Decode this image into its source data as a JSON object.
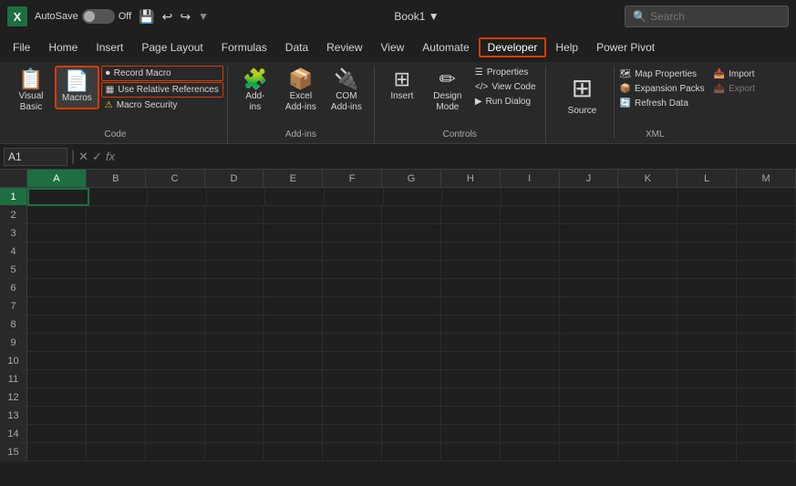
{
  "titleBar": {
    "logo": "X",
    "autosave": "AutoSave",
    "toggleState": "Off",
    "bookName": "Book1",
    "searchPlaceholder": "Search",
    "undoSymbol": "↩",
    "redoSymbol": "↪"
  },
  "menuBar": {
    "items": [
      "File",
      "Home",
      "Insert",
      "Page Layout",
      "Formulas",
      "Data",
      "Review",
      "View",
      "Automate",
      "Developer",
      "Help",
      "Power Pivot"
    ],
    "activeItem": "Developer"
  },
  "ribbon": {
    "groups": [
      {
        "label": "Code",
        "buttons": [
          {
            "id": "visual-basic",
            "icon": "📋",
            "label": "Visual\nBasic",
            "large": true,
            "highlighted": false
          },
          {
            "id": "macros",
            "icon": "📄",
            "label": "Macros",
            "large": true,
            "highlighted": true
          }
        ],
        "smallButtons": [
          {
            "id": "record-macro",
            "icon": "⏺",
            "label": "Record Macro",
            "highlighted": true
          },
          {
            "id": "use-relative",
            "icon": "▦",
            "label": "Use Relative References",
            "highlighted": true
          },
          {
            "id": "macro-security",
            "icon": "⚠",
            "label": "Macro Security",
            "warning": true,
            "highlighted": false
          }
        ]
      },
      {
        "label": "Add-ins",
        "buttons": [
          {
            "id": "add-ins",
            "icon": "🧩",
            "label": "Add-\nins",
            "large": true
          },
          {
            "id": "excel-add-ins",
            "icon": "📦",
            "label": "Excel\nAdd-ins",
            "large": true
          },
          {
            "id": "com-add-ins",
            "icon": "🔌",
            "label": "COM\nAdd-ins",
            "large": true
          }
        ]
      },
      {
        "label": "Controls",
        "buttons": [
          {
            "id": "insert-controls",
            "icon": "⊞",
            "label": "Insert",
            "large": true
          }
        ],
        "rightButtons": [
          {
            "id": "design-mode",
            "icon": "✏",
            "label": "Design\nMode",
            "large": true
          }
        ],
        "smallButtons": [
          {
            "id": "properties",
            "icon": "☰",
            "label": "Properties"
          },
          {
            "id": "view-code",
            "icon": "</>",
            "label": "View Code"
          },
          {
            "id": "run-dialog",
            "icon": "▶",
            "label": "Run Dialog"
          }
        ]
      },
      {
        "label": "XML",
        "sourceLabel": "Source",
        "sourceIcon": "⊞",
        "smallButtons": [
          {
            "id": "map-properties",
            "icon": "🗺",
            "label": "Map Properties",
            "highlighted": true
          },
          {
            "id": "expansion-packs",
            "icon": "📦",
            "label": "Expansion Packs",
            "highlighted": true
          },
          {
            "id": "refresh-data",
            "icon": "🔄",
            "label": "Refresh Data",
            "disabled": false
          },
          {
            "id": "import",
            "icon": "📥",
            "label": "Import"
          },
          {
            "id": "export",
            "icon": "📤",
            "label": "Export",
            "disabled": true
          }
        ]
      }
    ]
  },
  "formulaBar": {
    "cellRef": "A1",
    "cancelSymbol": "✕",
    "confirmSymbol": "✓",
    "functionSymbol": "fx",
    "formula": ""
  },
  "spreadsheet": {
    "columns": [
      "A",
      "B",
      "C",
      "D",
      "E",
      "F",
      "G",
      "H",
      "I",
      "J",
      "K",
      "L",
      "M"
    ],
    "rows": 15,
    "activeCell": "A1"
  }
}
